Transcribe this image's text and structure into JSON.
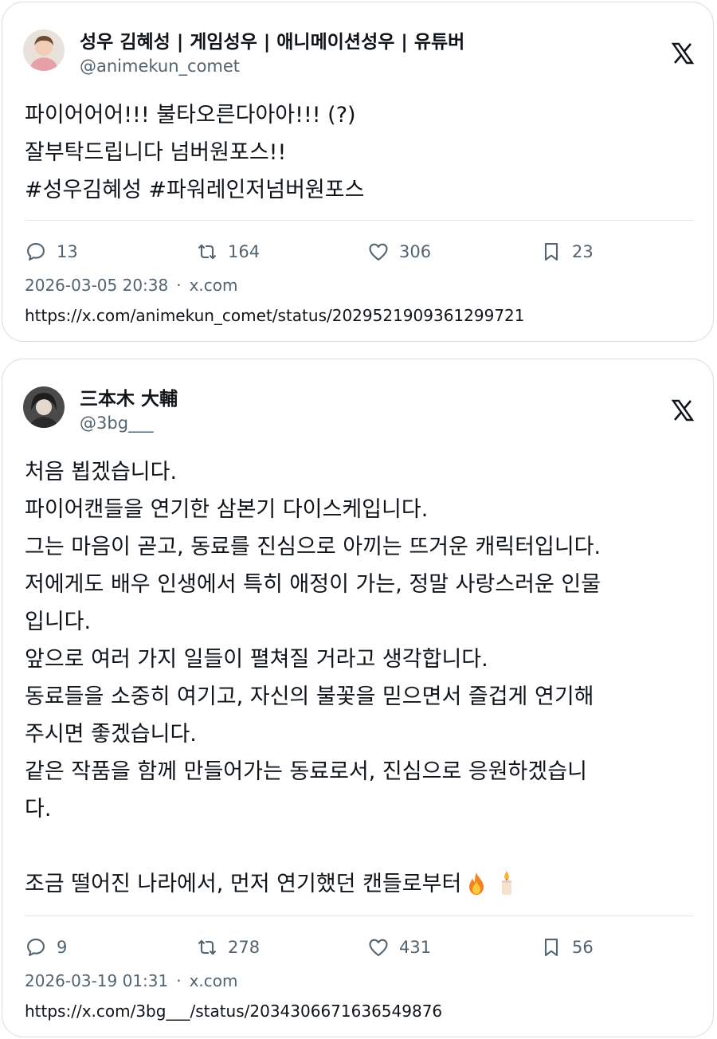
{
  "posts": [
    {
      "display_name": "성우 김혜성 | 게임성우 | 애니메이션성우 | 유튜버",
      "handle": "@animekun_comet",
      "body_lines": [
        "파이어어어!!! 불타오른다아아!!! (?)",
        "잘부탁드립니다 넘버원포스!!",
        "#성우김혜성 #파워레인저넘버원포스"
      ],
      "stats": {
        "replies": "13",
        "reposts": "164",
        "likes": "306",
        "bookmarks": "23"
      },
      "timestamp": "2026-03-05 20:38",
      "source": "x.com",
      "url": "https://x.com/animekun_comet/status/2029521909361299721",
      "platform_icon": "x-logo-icon"
    },
    {
      "display_name": "三本木 大輔",
      "handle": "@3bg___",
      "body_lines": [
        "처음 뵙겠습니다.",
        "파이어캔들을 연기한 삼본기 다이스케입니다.",
        "그는 마음이 곧고, 동료를 진심으로 아끼는 뜨거운 캐릭터입니다.",
        "저에게도 배우 인생에서 특히 애정이 가는, 정말 사랑스러운 인물",
        "입니다.",
        "앞으로 여러 가지 일들이 펼쳐질 거라고 생각합니다.",
        "동료들을 소중히 여기고, 자신의 불꽃을 믿으면서 즐겁게 연기해",
        "주시면 좋겠습니다.",
        "같은 작품을 함께 만들어가는 동료로서, 진심으로 응원하겠습니",
        "다.",
        "",
        "조금 떨어진 나라에서, 먼저 연기했던 캔들로부터"
      ],
      "trailing_emojis": [
        "fire-emoji",
        "candle-emoji"
      ],
      "stats": {
        "replies": "9",
        "reposts": "278",
        "likes": "431",
        "bookmarks": "56"
      },
      "timestamp": "2026-03-19 01:31",
      "source": "x.com",
      "url": "https://x.com/3bg___/status/2034306671636549876",
      "platform_icon": "x-logo-icon"
    }
  ],
  "colors": {
    "text": "#0f1419",
    "secondary": "#536471",
    "border": "#d8dde1"
  }
}
